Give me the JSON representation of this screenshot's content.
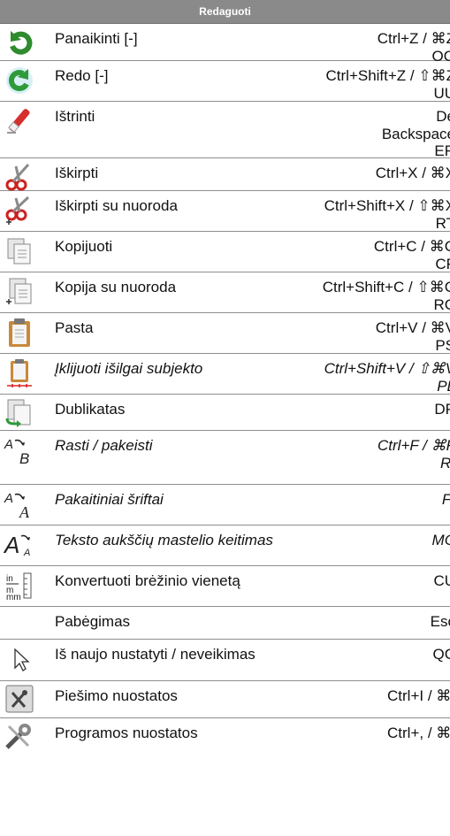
{
  "menu_title": "Redaguoti",
  "items": [
    {
      "label": "Panaikinti [-]",
      "keys": [
        "Ctrl+Z / ⌘Z",
        "OO"
      ],
      "italic": false,
      "icon": "undo-icon"
    },
    {
      "label": "Redo [-]",
      "keys": [
        "Ctrl+Shift+Z / ⇧⌘Z",
        "UU"
      ],
      "italic": false,
      "icon": "redo-icon"
    },
    {
      "label": "Ištrinti",
      "keys": [
        "De",
        "Backspace",
        "ER"
      ],
      "italic": false,
      "icon": "eraser-icon"
    },
    {
      "label": "Iškirpti",
      "keys": [
        "Ctrl+X / ⌘X"
      ],
      "italic": false,
      "icon": "scissors-icon"
    },
    {
      "label": "Iškirpti su nuoroda",
      "keys": [
        "Ctrl+Shift+X / ⇧⌘X",
        "RT"
      ],
      "italic": false,
      "icon": "scissors-base-icon"
    },
    {
      "label": "Kopijuoti",
      "keys": [
        "Ctrl+C / ⌘C",
        "CF"
      ],
      "italic": false,
      "icon": "copy-icon"
    },
    {
      "label": "Kopija su nuoroda",
      "keys": [
        "Ctrl+Shift+C / ⇧⌘C",
        "RC"
      ],
      "italic": false,
      "icon": "copy-base-icon"
    },
    {
      "label": "Pasta",
      "keys": [
        "Ctrl+V / ⌘V",
        "PS"
      ],
      "italic": false,
      "icon": "paste-icon"
    },
    {
      "label": "Įklijuoti išilgai subjekto",
      "keys": [
        "Ctrl+Shift+V / ⇧⌘V",
        "PL"
      ],
      "italic": true,
      "icon": "paste-along-entity-icon"
    },
    {
      "label": "Dublikatas",
      "keys": [
        "DP"
      ],
      "italic": false,
      "icon": "duplicate-icon"
    },
    {
      "label": "Rasti / pakeisti",
      "keys": [
        "Ctrl+F / ⌘F",
        "RI"
      ],
      "italic": true,
      "icon": "find-replace-icon"
    },
    {
      "label": "Pakaitiniai šriftai",
      "keys": [
        "FI"
      ],
      "italic": true,
      "icon": "substitute-fonts-icon"
    },
    {
      "label": "Teksto aukščių mastelio keitimas",
      "keys": [
        "MC"
      ],
      "italic": true,
      "icon": "text-height-scale-icon"
    },
    {
      "label": "Konvertuoti brėžinio vienetą",
      "keys": [
        "CU"
      ],
      "italic": false,
      "icon": "convert-units-icon"
    },
    {
      "label": "Pabėgimas",
      "keys": [
        "Esc"
      ],
      "italic": false,
      "icon": ""
    },
    {
      "label": "Iš naujo nustatyti / neveikimas",
      "keys": [
        "QC"
      ],
      "italic": false,
      "icon": "cursor-icon"
    },
    {
      "label": "Piešimo nuostatos",
      "keys": [
        "Ctrl+I / ⌘I"
      ],
      "italic": false,
      "icon": "drawing-settings-icon"
    },
    {
      "label": "Programos nuostatos",
      "keys": [
        "Ctrl+, / ⌘,"
      ],
      "italic": false,
      "icon": "app-settings-icon"
    }
  ]
}
